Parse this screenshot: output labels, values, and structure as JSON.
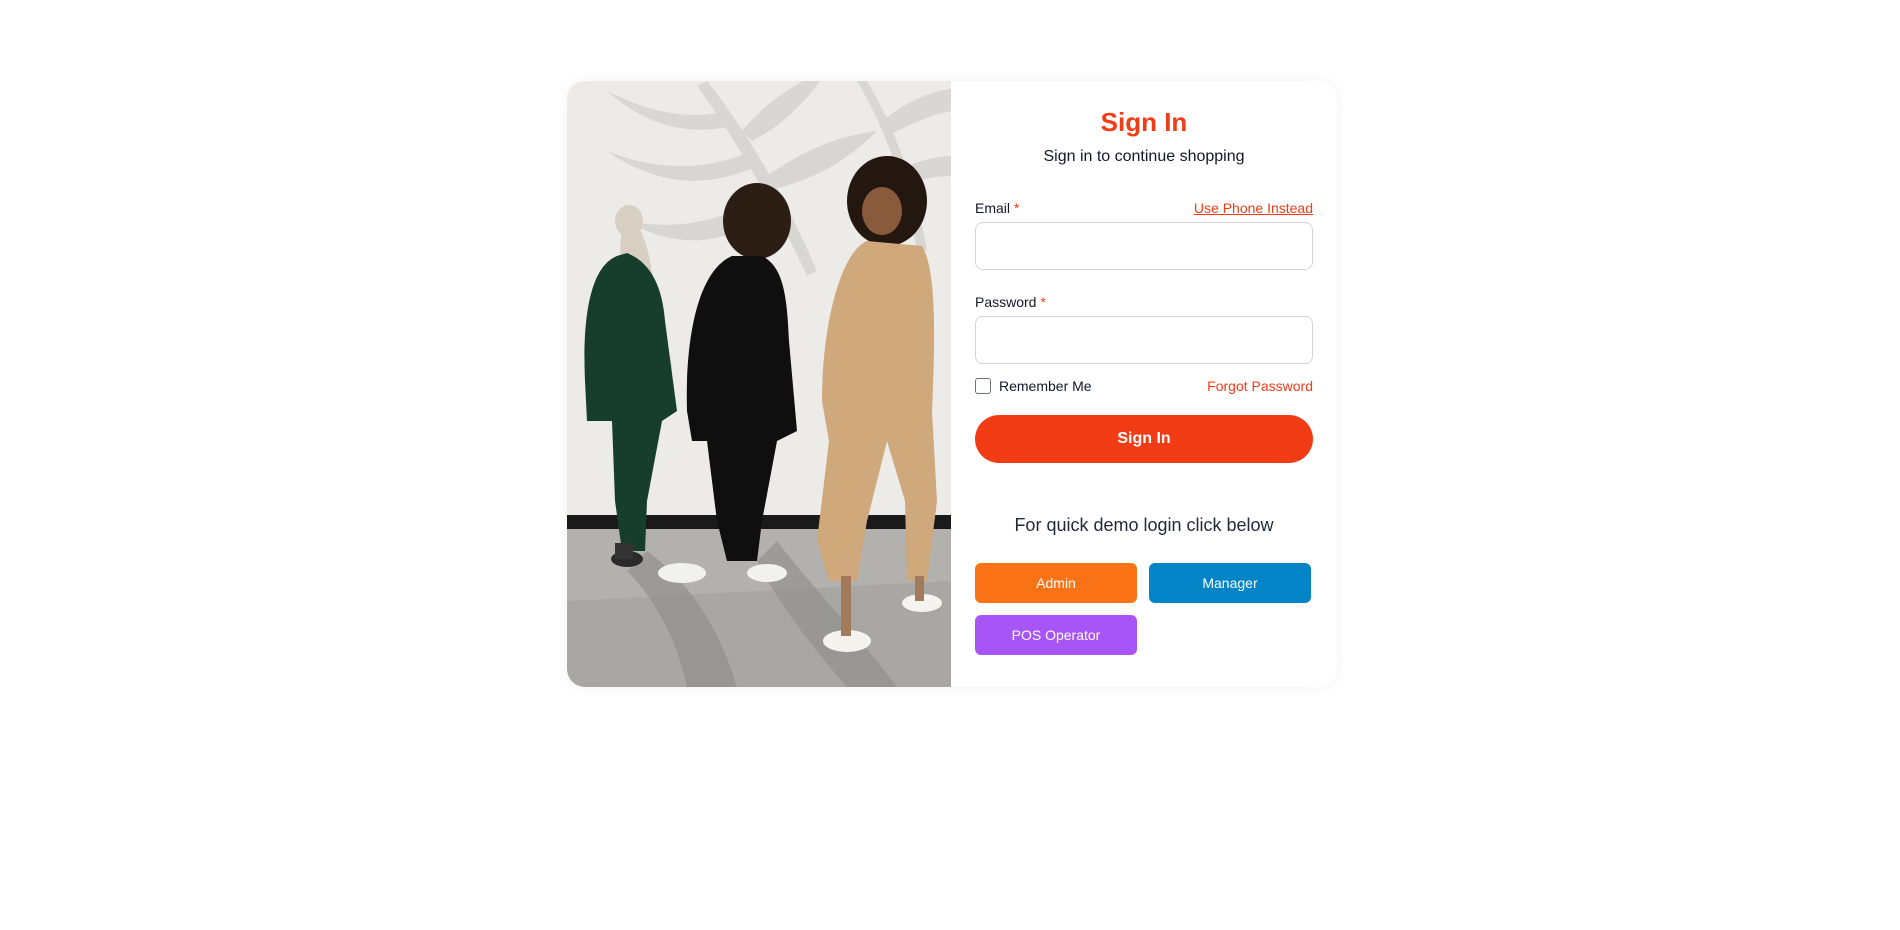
{
  "signin": {
    "title": "Sign In",
    "subtitle": "Sign in to continue shopping",
    "email_label": "Email",
    "required_mark": "*",
    "use_phone_link": "Use Phone Instead",
    "email_value": "",
    "password_label": "Password",
    "password_value": "",
    "remember_me": "Remember Me",
    "forgot_password": "Forgot Password",
    "submit_label": "Sign In"
  },
  "demo": {
    "prompt": "For quick demo login click below",
    "buttons": [
      {
        "label": "Admin",
        "color": "#f97316"
      },
      {
        "label": "Manager",
        "color": "#0284c7"
      },
      {
        "label": "POS Operator",
        "color": "#a855f7"
      }
    ]
  },
  "colors": {
    "accent": "#f23c16"
  },
  "photo": {
    "icon": "fashion-photo"
  }
}
